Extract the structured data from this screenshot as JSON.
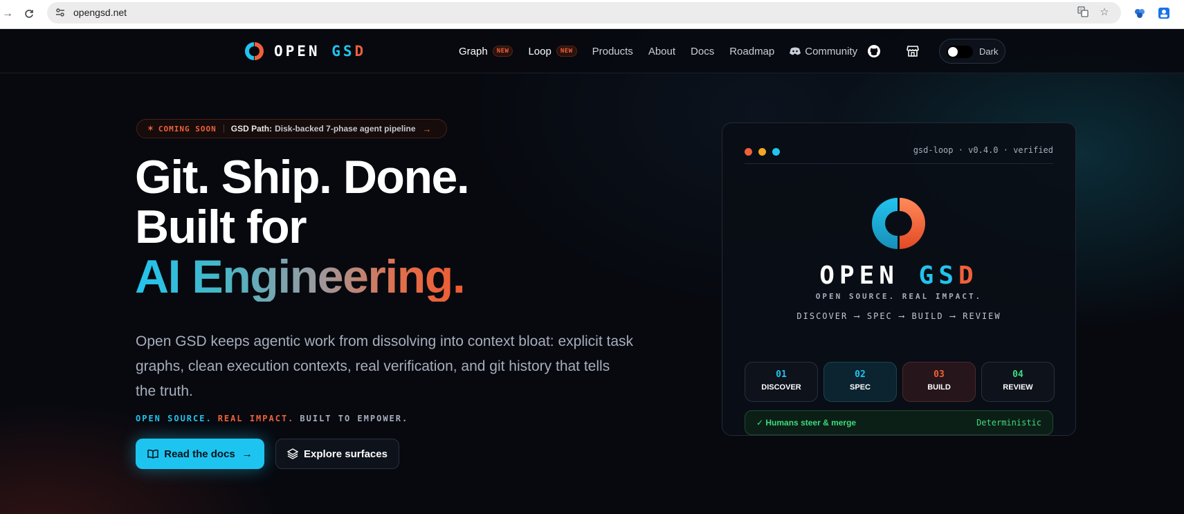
{
  "browser": {
    "url": "opengsd.net"
  },
  "header": {
    "brand": {
      "open": "OPEN",
      "gs": "GS",
      "d": "D"
    },
    "nav": [
      {
        "label": "Graph",
        "badge": "NEW"
      },
      {
        "label": "Loop",
        "badge": "NEW"
      },
      {
        "label": "Products"
      },
      {
        "label": "About"
      },
      {
        "label": "Docs"
      },
      {
        "label": "Roadmap"
      },
      {
        "label": "Community"
      }
    ],
    "theme_toggle_label": "Dark"
  },
  "hero": {
    "announcement": {
      "tag": "COMING SOON",
      "title": "GSD Path:",
      "text": "Disk-backed 7-phase agent pipeline"
    },
    "headline": [
      "Git. Ship. Done.",
      "Built for",
      "AI Engineering."
    ],
    "lead": "Open GSD keeps agentic work from dissolving into context bloat: explicit task graphs, clean execution contexts, real verification, and git history that tells the truth.",
    "tagline": [
      "OPEN SOURCE.",
      "REAL IMPACT.",
      "BUILT TO EMPOWER."
    ],
    "primary_button": "Read the docs",
    "secondary_button": "Explore surfaces"
  },
  "card": {
    "title": "gsd-loop · v0.4.0 · verified",
    "brand": {
      "open": "OPEN",
      "gs": "GS",
      "d": "D"
    },
    "subtitle": "OPEN SOURCE. REAL IMPACT.",
    "flow": "DISCOVER ⟶ SPEC ⟶ BUILD ⟶ REVIEW",
    "phases": [
      {
        "num": "01",
        "name": "DISCOVER",
        "color": "#22c3ee"
      },
      {
        "num": "02",
        "name": "SPEC",
        "color": "#22c3ee"
      },
      {
        "num": "03",
        "name": "BUILD",
        "color": "#f0603a"
      },
      {
        "num": "04",
        "name": "REVIEW",
        "color": "#3ddc7d"
      }
    ],
    "status": "✓ Humans steer & merge",
    "mode": "Deterministic"
  },
  "colors": {
    "cyan": "#22c3ee",
    "orange": "#f0603a",
    "green": "#3ddc7d",
    "background": "#07090f"
  }
}
